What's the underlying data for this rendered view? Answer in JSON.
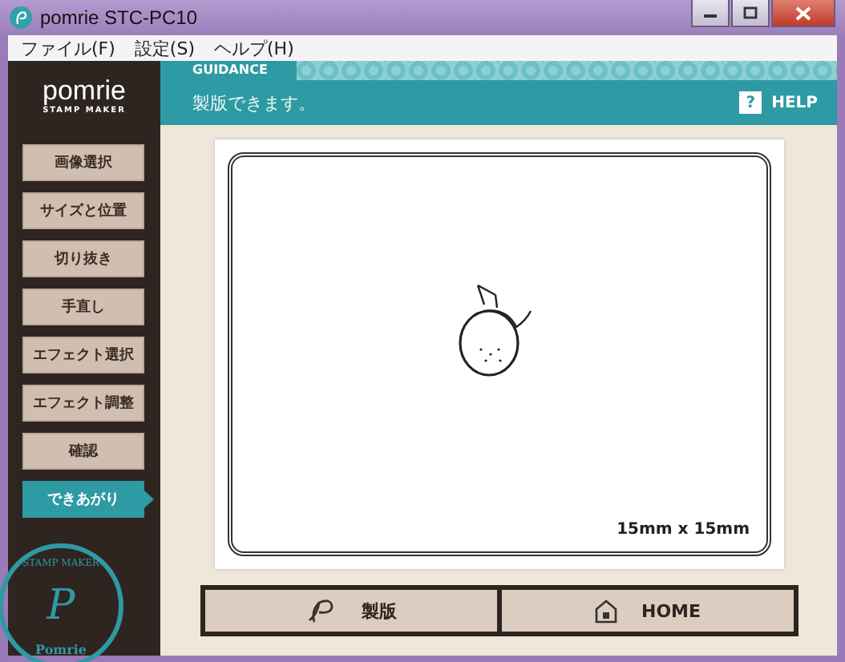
{
  "window": {
    "title": "pomrie STC-PC10"
  },
  "menu": [
    "ファイル(F)",
    "設定(S)",
    "ヘルプ(H)"
  ],
  "logo": {
    "name": "pomrie",
    "tagline": "STAMP MAKER"
  },
  "guidance": {
    "label": "GUIDANCE",
    "message": "製版できます。",
    "help": "HELP",
    "help_glyph": "?"
  },
  "steps": [
    {
      "label": "画像選択",
      "selected": false
    },
    {
      "label": "サイズと位置",
      "selected": false
    },
    {
      "label": "切り抜き",
      "selected": false
    },
    {
      "label": "手直し",
      "selected": false
    },
    {
      "label": "エフェクト選択",
      "selected": false
    },
    {
      "label": "エフェクト調整",
      "selected": false
    },
    {
      "label": "確認",
      "selected": false
    },
    {
      "label": "できあがり",
      "selected": true
    }
  ],
  "stamp_badge": {
    "top": "STAMP MAKER",
    "letter": "P",
    "bottom": "Pomrie"
  },
  "preview": {
    "size": "15mm x 15mm"
  },
  "buttons": [
    {
      "kind": "make",
      "label": "製版"
    },
    {
      "kind": "home",
      "label": "HOME"
    }
  ]
}
